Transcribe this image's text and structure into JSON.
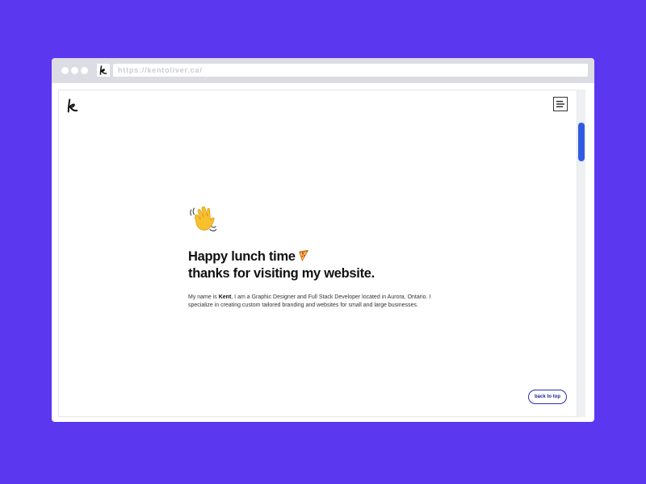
{
  "browser": {
    "url": "https://kentoliver.ca/",
    "favicon_icon": "kent-logo-icon",
    "window_controls": [
      "close-dot",
      "minimize-dot",
      "maximize-dot"
    ]
  },
  "site": {
    "logo_icon": "kent-logo-icon",
    "menu_icon": "hamburger-menu-icon",
    "greeting_icon": "waving-hand-icon",
    "headline_line1": "Happy lunch time",
    "headline_icon": "pizza-icon",
    "headline_line2": "thanks for visiting my website.",
    "intro_prefix": "My name is ",
    "intro_name": "Kent",
    "intro_suffix": ", I am a Graphic Designer and Full Stack Developer located in Aurora, Ontario. I specialize in creating custom tailored branding and websites for small and large businesses.",
    "back_to_top_label": "back to top"
  },
  "colors": {
    "background": "#5b37ef",
    "accent": "#2f5be0",
    "button_border": "#2b2fb3"
  }
}
